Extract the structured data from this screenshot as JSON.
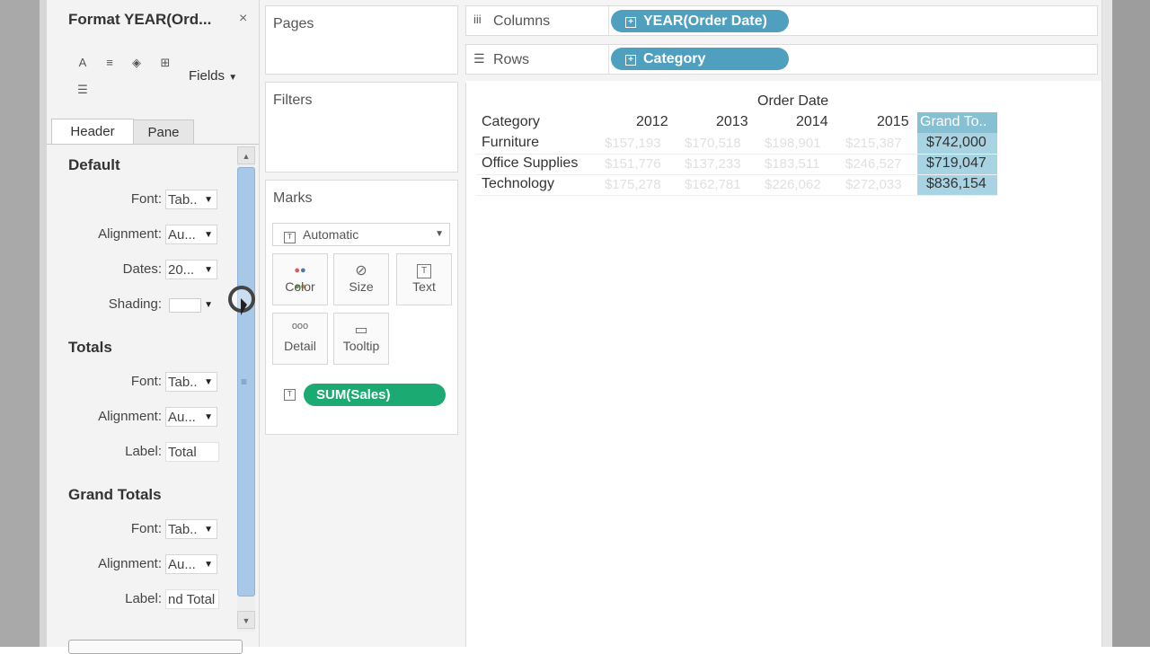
{
  "format_pane": {
    "title": "Format YEAR(Ord...",
    "close": "×",
    "fields_label": "Fields",
    "tabs": [
      "Header",
      "Pane"
    ],
    "sections": {
      "default": {
        "heading": "Default",
        "font_label": "Font:",
        "font_value": "Tab..",
        "alignment_label": "Alignment:",
        "alignment_value": "Au...",
        "dates_label": "Dates:",
        "dates_value": "20...",
        "shading_label": "Shading:"
      },
      "totals": {
        "heading": "Totals",
        "font_label": "Font:",
        "font_value": "Tab..",
        "alignment_label": "Alignment:",
        "alignment_value": "Au...",
        "label_label": "Label:",
        "label_value": "Total"
      },
      "grand_totals": {
        "heading": "Grand Totals",
        "font_label": "Font:",
        "font_value": "Tab..",
        "alignment_label": "Alignment:",
        "alignment_value": "Au...",
        "label_label": "Label:",
        "label_value": "nd Total"
      }
    }
  },
  "cards": {
    "pages": "Pages",
    "filters": "Filters",
    "marks": "Marks",
    "mark_type": "Automatic",
    "mark_buttons": [
      "Color",
      "Size",
      "Text",
      "Detail",
      "Tooltip"
    ],
    "mark_field": "SUM(Sales)"
  },
  "shelves": {
    "columns_label": "Columns",
    "columns_pill": "YEAR(Order Date)",
    "rows_label": "Rows",
    "rows_pill": "Category"
  },
  "view": {
    "column_title": "Order Date",
    "row_header": "Category",
    "years": [
      "2012",
      "2013",
      "2014",
      "2015"
    ],
    "grand_total_header": "Grand To..",
    "rows": [
      {
        "category": "Furniture",
        "values": [
          "$157,193",
          "$170,518",
          "$198,901",
          "$215,387"
        ],
        "total": "$742,000"
      },
      {
        "category": "Office Supplies",
        "values": [
          "$151,776",
          "$137,233",
          "$183,511",
          "$246,527"
        ],
        "total": "$719,047"
      },
      {
        "category": "Technology",
        "values": [
          "$175,278",
          "$162,781",
          "$226,062",
          "$272,033"
        ],
        "total": "$836,154"
      }
    ]
  },
  "colors": {
    "pill_blue": "#4f9fbf",
    "pill_green": "#1bab72",
    "grand_total_band": "#a7d3e3"
  }
}
